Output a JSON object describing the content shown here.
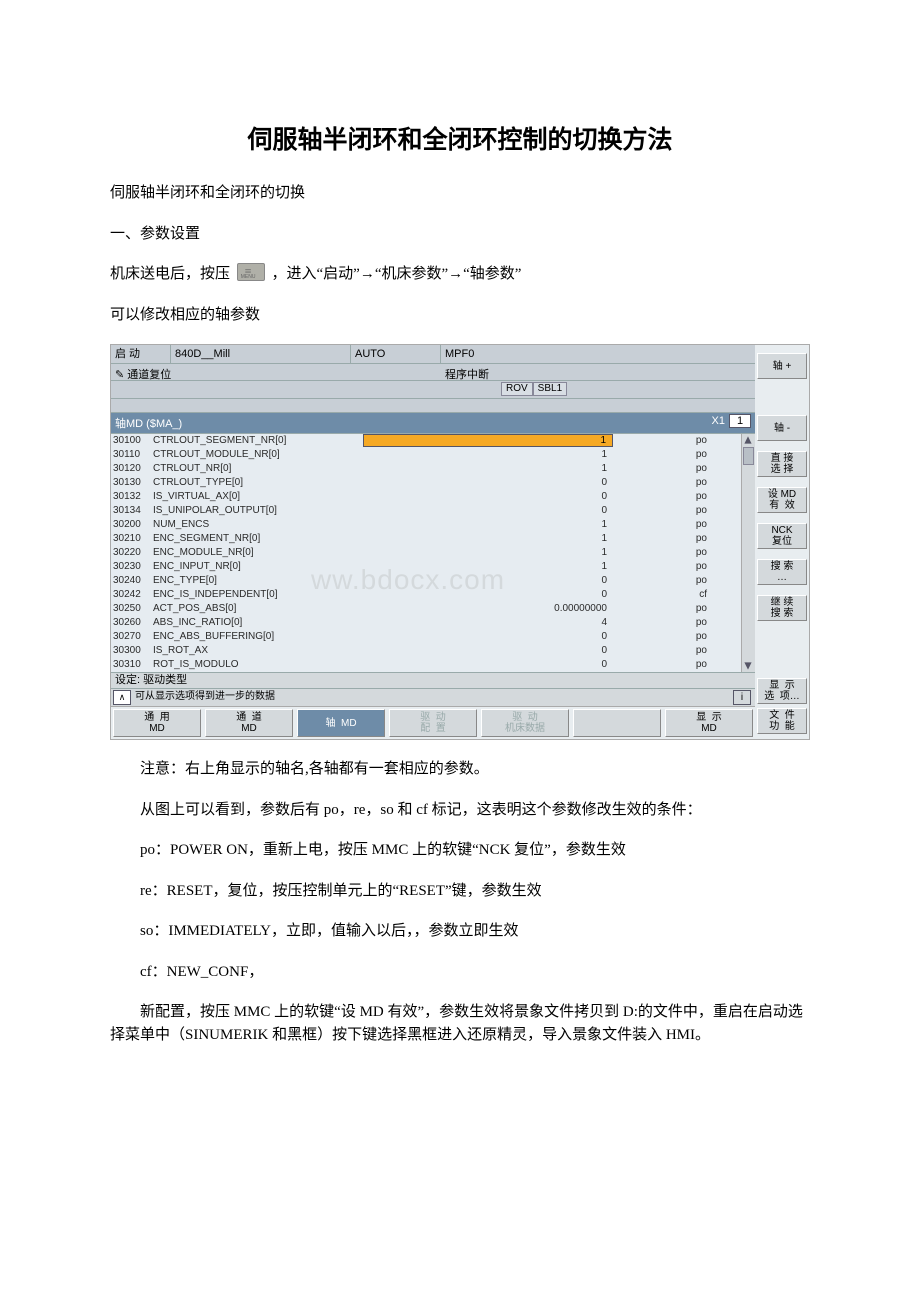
{
  "doc": {
    "title": "伺服轴半闭环和全闭环控制的切换方法",
    "p1": "伺服轴半闭环和全闭环的切换",
    "p2": "一、参数设置",
    "p3a": "机床送电后，按压",
    "p3b": "，进入“启动”→“机床参数”→“轴参数”",
    "p4": "可以修改相应的轴参数",
    "note1": "注意：右上角显示的轴名,各轴都有一套相应的参数。",
    "note2": "从图上可以看到，参数后有 po，re，so 和 cf 标记，这表明这个参数修改生效的条件：",
    "note3": "po：POWER ON，重新上电，按压 MMC 上的软键“NCK 复位”，参数生效",
    "note4": "re：RESET，复位，按压控制单元上的“RESET”键，参数生效",
    "note5": "so：IMMEDIATELY，立即，值输入以后，，参数立即生效",
    "note6": "cf：NEW_CONF，",
    "note7": "新配置，按压 MMC 上的软键“设 MD 有效”，参数生效将景象文件拷贝到 D:的文件中，重启在启动选择菜单中（SINUMERIK 和黑框）按下键选择黑框进入还原精灵，导入景象文件装入 HMI。"
  },
  "hmi": {
    "header": {
      "start": "启  动",
      "program": "840D__Mill",
      "mode": "AUTO",
      "mpf": "MPF0",
      "reset_icon": "✎",
      "chan_reset": "通道复位",
      "prog_break": "程序中断",
      "badges": [
        "ROV",
        "SBL1"
      ]
    },
    "filter": {
      "label": "轴MD ($MA_)",
      "axis_name": "X1",
      "axis_idx": "1"
    },
    "rows": [
      {
        "id": "30100",
        "name": "CTRLOUT_SEGMENT_NR[0]",
        "val": "1",
        "eff": "po",
        "sel": true
      },
      {
        "id": "30110",
        "name": "CTRLOUT_MODULE_NR[0]",
        "val": "1",
        "eff": "po"
      },
      {
        "id": "30120",
        "name": "CTRLOUT_NR[0]",
        "val": "1",
        "eff": "po"
      },
      {
        "id": "30130",
        "name": "CTRLOUT_TYPE[0]",
        "val": "0",
        "eff": "po"
      },
      {
        "id": "30132",
        "name": "IS_VIRTUAL_AX[0]",
        "val": "0",
        "eff": "po"
      },
      {
        "id": "30134",
        "name": "IS_UNIPOLAR_OUTPUT[0]",
        "val": "0",
        "eff": "po"
      },
      {
        "id": "30200",
        "name": "NUM_ENCS",
        "val": "1",
        "eff": "po"
      },
      {
        "id": "30210",
        "name": "ENC_SEGMENT_NR[0]",
        "val": "1",
        "eff": "po"
      },
      {
        "id": "30220",
        "name": "ENC_MODULE_NR[0]",
        "val": "1",
        "eff": "po"
      },
      {
        "id": "30230",
        "name": "ENC_INPUT_NR[0]",
        "val": "1",
        "eff": "po"
      },
      {
        "id": "30240",
        "name": "ENC_TYPE[0]",
        "val": "0",
        "eff": "po"
      },
      {
        "id": "30242",
        "name": "ENC_IS_INDEPENDENT[0]",
        "val": "0",
        "eff": "cf"
      },
      {
        "id": "30250",
        "name": "ACT_POS_ABS[0]",
        "val": "0.00000000",
        "eff": "po"
      },
      {
        "id": "30260",
        "name": "ABS_INC_RATIO[0]",
        "val": "4",
        "eff": "po"
      },
      {
        "id": "30270",
        "name": "ENC_ABS_BUFFERING[0]",
        "val": "0",
        "eff": "po"
      },
      {
        "id": "30300",
        "name": "IS_ROT_AX",
        "val": "0",
        "eff": "po"
      },
      {
        "id": "30310",
        "name": "ROT_IS_MODULO",
        "val": "0",
        "eff": "po"
      }
    ],
    "status_line": "设定: 驱动类型",
    "hint_icon": "∧",
    "hint_text": "可从显示选项得到进一步的数据",
    "info_icon": "i",
    "right_keys": [
      "轴 +",
      "",
      "轴 -",
      "",
      "直 接\n选 择",
      "",
      "设 MD\n有  效",
      "",
      "NCK\n复位",
      "",
      "搜 索\n…",
      "",
      "继 续\n搜 索"
    ],
    "right_keys_tail": [
      "显  示\n选  项…",
      "文  件\n功  能"
    ],
    "bottom_keys": [
      {
        "label": "通  用\nMD"
      },
      {
        "label": "通  道\nMD"
      },
      {
        "label": "轴  MD",
        "active": true
      },
      {
        "label": "驱  动\n配  置",
        "dim": true
      },
      {
        "label": "驱  动\n机床数据",
        "dim": true
      },
      {
        "label": ""
      },
      {
        "label": "显  示\nMD"
      }
    ],
    "watermark": "ww.bdocx.com"
  }
}
